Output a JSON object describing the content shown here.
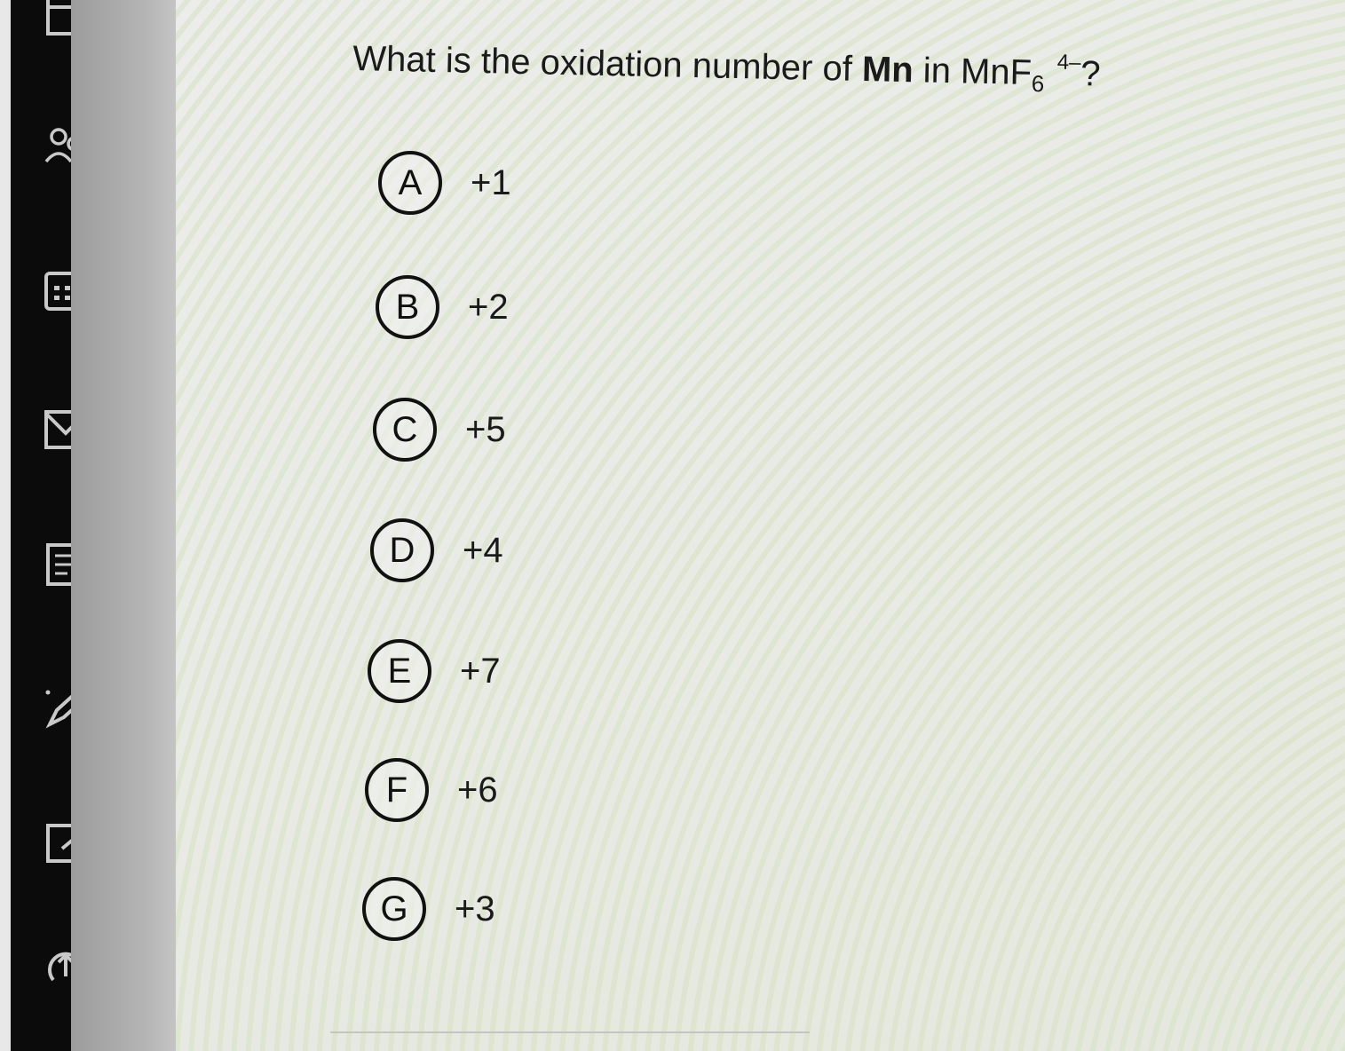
{
  "question": {
    "prefix": "What is the oxidation number of ",
    "element": "Mn",
    "middle": " in MnF",
    "subscript": "6",
    "charge": "4–",
    "suffix": "?"
  },
  "options": [
    {
      "letter": "A",
      "value": "+1"
    },
    {
      "letter": "B",
      "value": "+2"
    },
    {
      "letter": "C",
      "value": "+5"
    },
    {
      "letter": "D",
      "value": "+4"
    },
    {
      "letter": "E",
      "value": "+7"
    },
    {
      "letter": "F",
      "value": "+6"
    },
    {
      "letter": "G",
      "value": "+3"
    }
  ],
  "sidebar": {
    "icons": [
      "window-icon",
      "people-icon",
      "calculator-icon",
      "mail-icon",
      "notes-icon",
      "pen-icon",
      "edit-icon",
      "back-icon"
    ]
  }
}
